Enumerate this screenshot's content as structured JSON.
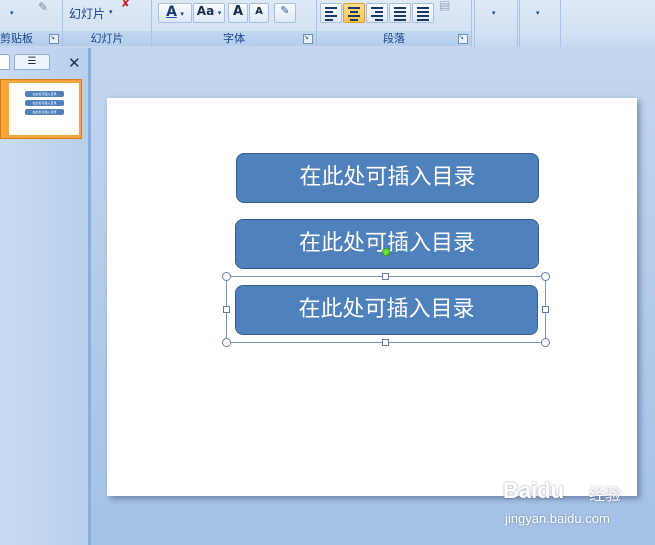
{
  "ribbon": {
    "clipboard": {
      "label": "剪贴板"
    },
    "slides": {
      "label": "幻灯片",
      "new_slide_label": "幻灯片"
    },
    "font": {
      "label": "字体",
      "font_color": "A",
      "change_case": "Aa",
      "grow": "A",
      "shrink": "A"
    },
    "paragraph": {
      "label": "段落"
    }
  },
  "slide": {
    "items": [
      {
        "text": "在此处可插入目录"
      },
      {
        "text": "在此处可插入目录"
      },
      {
        "text": "在此处可插入目录"
      }
    ]
  },
  "watermark": {
    "logo": "Baidu",
    "cn": "经验",
    "url": "jingyan.baidu.com"
  },
  "colors": {
    "shape_fill": "#4f81bd",
    "shape_border": "#385d8a",
    "thumb_highlight": "#f6a63c",
    "ribbon_text": "#15428b"
  }
}
